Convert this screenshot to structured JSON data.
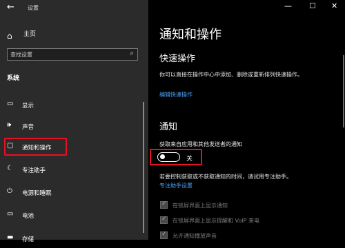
{
  "window": {
    "title": "设置",
    "back_icon": "←",
    "min_icon": "—",
    "max_icon": "☐",
    "close_icon": "✕"
  },
  "sidebar": {
    "home": {
      "label": "主页",
      "icon": "⌂"
    },
    "search": {
      "placeholder": "查找设置",
      "icon": "⌕"
    },
    "section": "系统",
    "items": [
      {
        "label": "显示",
        "icon": "▭"
      },
      {
        "label": "声音",
        "icon": "🕪"
      },
      {
        "label": "通知和操作",
        "icon": "▢",
        "active": true
      },
      {
        "label": "专注助手",
        "icon": "☾"
      },
      {
        "label": "电源和睡眠",
        "icon": "⏻"
      },
      {
        "label": "电池",
        "icon": "▭"
      },
      {
        "label": "存储",
        "icon": "▬"
      }
    ]
  },
  "main": {
    "title": "通知和操作",
    "quick": {
      "heading": "快速操作",
      "desc": "你可以直接在操作中心中添加、删除或重新排列快速操作。",
      "link": "编辑快速操作"
    },
    "notifications": {
      "heading": "通知",
      "toggle_label": "获取来自应用和其他发送者的通知",
      "toggle_state": "关",
      "toggle_on": false,
      "desc": "若要控制获取或不获取通知的时间，请试用专注助手。",
      "link": "专注助手设置",
      "checkboxes": [
        {
          "label": "在锁屏界面上显示通知",
          "checked": true,
          "enabled": false
        },
        {
          "label": "在锁屏界面上显示提醒和 VoIP 来电",
          "checked": true,
          "enabled": false
        },
        {
          "label": "允许通知播放声音",
          "checked": true,
          "enabled": false
        }
      ]
    }
  },
  "colors": {
    "sidebar_bg": "#2b2b2b",
    "main_bg": "#000000",
    "link": "#4aa5ff",
    "highlight_border": "#e81123"
  }
}
